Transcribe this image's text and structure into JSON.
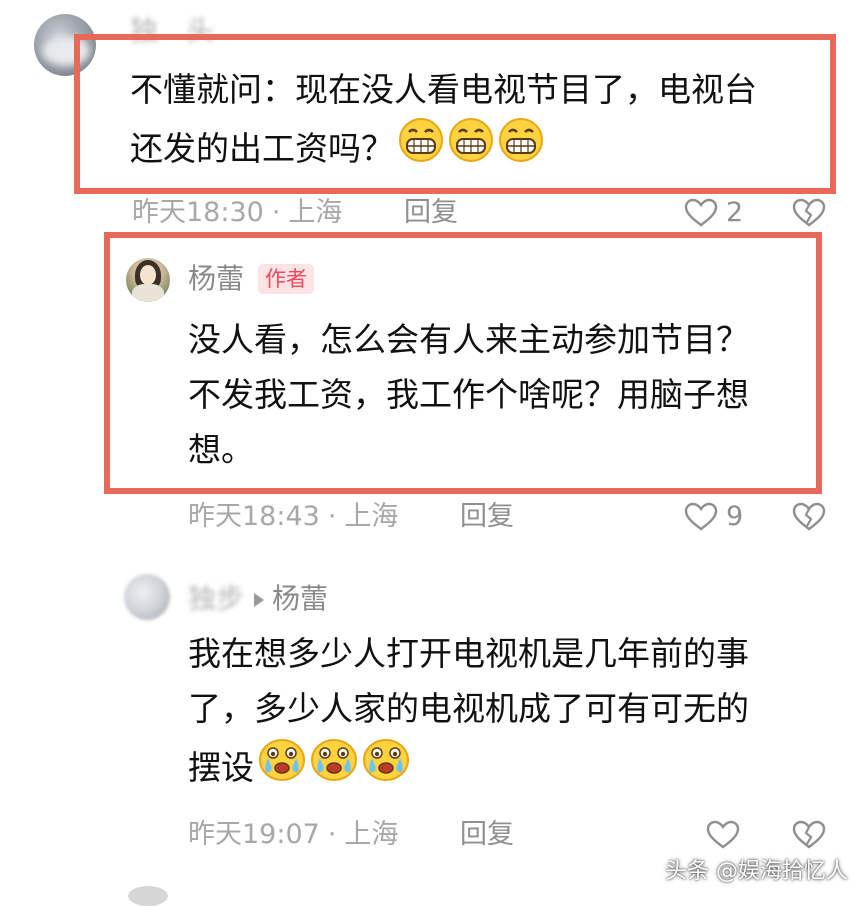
{
  "comments": [
    {
      "username": "独",
      "username_tail": "头",
      "text_lines": [
        "不懂就问：现在没人看电视节目了，电视台",
        "还发的出工资吗？"
      ],
      "emoji": [
        "grin-emoji",
        "grin-emoji",
        "grin-emoji"
      ],
      "time": "昨天18:30",
      "location": "上海",
      "reply_label": "回复",
      "likes": "2"
    },
    {
      "username": "杨蕾",
      "badge": "作者",
      "text_lines": [
        "没人看，怎么会有人来主动参加节目？",
        "不发我工资，我工作个啥呢？用脑子想",
        "想。"
      ],
      "time": "昨天18:43",
      "location": "上海",
      "reply_label": "回复",
      "likes": "9"
    },
    {
      "username": "独步",
      "reply_to": "杨蕾",
      "text_lines": [
        "我在想多少人打开电视机是几年前的事",
        "了，多少人家的电视机成了可有可无的",
        "摆设"
      ],
      "emoji": [
        "crying-emoji",
        "crying-emoji",
        "crying-emoji"
      ],
      "time": "昨天19:07",
      "location": "上海",
      "reply_label": "回复"
    }
  ],
  "meta_separator": "·",
  "watermark": "头条 @娱海拾忆人",
  "colors": {
    "highlight": "#e8685a",
    "badge_bg": "#fce3e6",
    "badge_text": "#f0495e",
    "meta": "#a8a8a8"
  }
}
